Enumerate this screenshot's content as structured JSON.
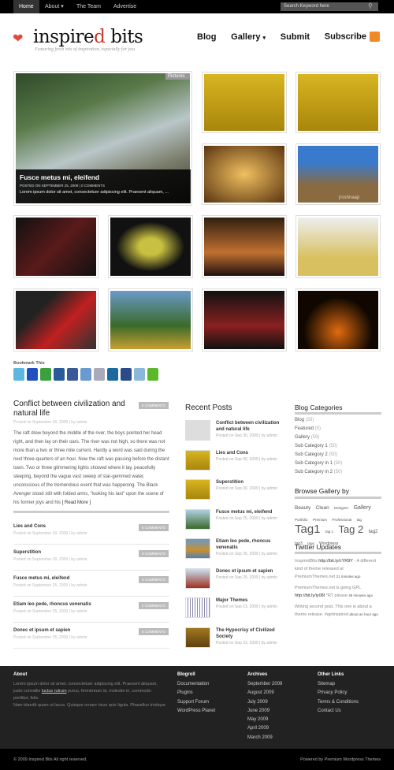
{
  "topnav": {
    "items": [
      "Home",
      "About",
      "The Team",
      "Advertise"
    ],
    "search_placeholder": "Search Keyword here"
  },
  "header": {
    "logo_pre": "inspire",
    "logo_red": "d",
    "logo_post": " bits",
    "tagline": "Featuring fresh bits of inspiration, especially for you",
    "nav": [
      "Blog",
      "Gallery",
      "Submit",
      "Subscribe"
    ]
  },
  "featured": {
    "badge": "Pictures",
    "title": "Fusce metus mi, eleifend",
    "meta": "POSTED ON SEPTEMBER 25, 2009 | 0 COMMENTS",
    "excerpt": "Lorem ipsum dolor sit amet, consectetuer adipiscing elit. Praesent aliquam, ..."
  },
  "gallery": {
    "watermark": "jroshnaap"
  },
  "bookmark": {
    "title": "Bookmark This",
    "icons": [
      "twitter-icon",
      "delicious-icon",
      "stumbleupon-icon",
      "myspace-icon",
      "facebook-icon",
      "mixx-icon",
      "google-icon",
      "linkedin-icon",
      "windows-live-icon",
      "reddit-icon",
      "technorati-icon"
    ]
  },
  "main_post": {
    "title": "Conflict between civilization and natural life",
    "comments": "0 COMMENTS",
    "meta": "Posted on September 30, 2009 | by admin",
    "body": "The raft drew beyond the middle of the river, the boys pointed her head right, and then lay on their oars. The river was not high, so there was not more than a two or three mile current. Hardly a word was said during the next three-quarters of an hour. Now the raft was passing before the distant town. Two or three glimmering lights showed where it lay, peacefully sleeping, beyond the vague vast sweep of star-gemmed water, unconscious of the tremendous event that was happening. The Black Avenger stood still with folded arms, \"looking his last\" upon the scene of his former joys and his ",
    "read_more": "[ Read More ]"
  },
  "posts": [
    {
      "title": "Lies and Cons",
      "meta": "Posted on September 30, 2009 | by admin",
      "comments": "0 COMMENTS"
    },
    {
      "title": "Superstition",
      "meta": "Posted on September 30, 2009 | by admin",
      "comments": "0 COMMENTS"
    },
    {
      "title": "Fusce metus mi, eleifend",
      "meta": "Posted on September 25, 2009 | by admin",
      "comments": "0 COMMENTS"
    },
    {
      "title": "Etiam leo pede, rhoncus venenatis",
      "meta": "Posted on September 25, 2009 | by admin",
      "comments": "0 COMMENTS"
    },
    {
      "title": "Donec et ipsum et sapien",
      "meta": "Posted on September 25, 2009 | by admin",
      "comments": "0 COMMENTS"
    }
  ],
  "recent": {
    "title": "Recent Posts",
    "items": [
      {
        "title": "Conflict between civilization and natural life",
        "meta": "Posted on Sep 30, 2009 | by admin"
      },
      {
        "title": "Lies and Cons",
        "meta": "Posted on Sep 30, 2009 | by admin"
      },
      {
        "title": "Superstition",
        "meta": "Posted on Sep 30, 2009 | by admin"
      },
      {
        "title": "Fusce metus mi, eleifend",
        "meta": "Posted on Sep 25, 2009 | by admin"
      },
      {
        "title": "Etiam leo pede, rhoncus venenatis",
        "meta": "Posted on Sep 25, 2009 | by admin"
      },
      {
        "title": "Donec et ipsum et sapien",
        "meta": "Posted on Sep 25, 2009 | by admin"
      },
      {
        "title": "Major Themes",
        "meta": "Posted on Sep 23, 2009 | by admin"
      },
      {
        "title": "The Hypocrisy of Civilized Society",
        "meta": "Posted on Sep 23, 2009 | by admin"
      }
    ]
  },
  "categories": {
    "title": "Blog Categories",
    "items": [
      {
        "name": "Blog",
        "count": "(33)"
      },
      {
        "name": "Featured",
        "count": "(5)"
      },
      {
        "name": "Gallery",
        "count": "(59)"
      },
      {
        "name": "Sub Category 1",
        "count": "(50)"
      },
      {
        "name": "Sub Category 2",
        "count": "(50)"
      },
      {
        "name": "Sub Category in 1",
        "count": "(50)"
      },
      {
        "name": "Sub Category in 2",
        "count": "(50)"
      }
    ]
  },
  "tags": {
    "title": "Browse Gallery by",
    "items": [
      "Beauty",
      "Clean",
      "Designer",
      "Gallery",
      "Portfolio",
      "Premium",
      "Professional",
      "tag",
      "Tag1",
      "tag 1",
      "Tag 2",
      "tag2",
      "tag3",
      "tags",
      "Wordpress"
    ]
  },
  "twitter": {
    "title": "Twitter Updates",
    "tweets": [
      {
        "text": "InspiredBits ",
        "link": "http://bit.ly/cYR9Y",
        "rest": " - A different kind of theme released at PremiumThemes.net ",
        "time": "21 minutes ago"
      },
      {
        "text": "PremiumThemes.net is going GPL ",
        "link": "http://bit.ly/iy08I",
        "rest": " *RT please ",
        "time": "49 minutes ago"
      },
      {
        "text": "Writing second post. This one is about a theme release. #getinspired ",
        "link": "",
        "rest": "",
        "time": "about an hour ago"
      }
    ]
  },
  "footer": {
    "about": {
      "title": "About",
      "text1": "Lorem ipsum dolor sit amet, consectetuer adipiscing elit. Praesent aliquam, justo convallis ",
      "link": "luctus rutrum",
      "text2": " purus, fermentum id, molestie in, commodo porttitor, felis.",
      "text3": "Nam blandit quam ut lacus. Quisque ornare risus quis ligula. Phasellus tristique."
    },
    "blogroll": {
      "title": "Blogroll",
      "items": [
        "Documentation",
        "Plugins",
        "Support Forum",
        "WordPress Planet"
      ]
    },
    "archives": {
      "title": "Archives",
      "items": [
        "September 2009",
        "August 2009",
        "July 2009",
        "June 2009",
        "May 2009",
        "April 2009",
        "March 2009"
      ]
    },
    "other": {
      "title": "Other Links",
      "items": [
        "Sitemap",
        "Privacy Policy",
        "Terms & Conditions",
        "Contact Us"
      ]
    },
    "copyright": "© 2009 Inspired Bits All right reserved.",
    "powered": "Powered by Premium Wordpress Themes"
  },
  "colors": {
    "accent": "#c8382a",
    "rss": "#f08a24",
    "footer_bg": "#222222"
  }
}
